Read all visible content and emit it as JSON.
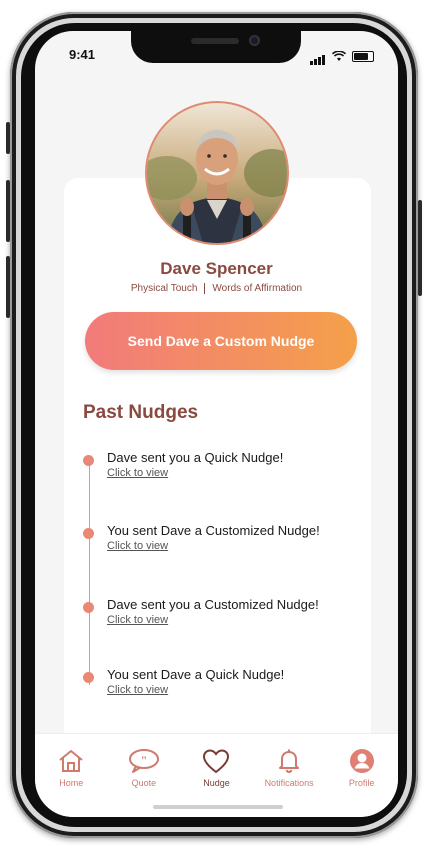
{
  "status_bar": {
    "time": "9:41"
  },
  "profile": {
    "name": "Dave Spencer",
    "love_languages": [
      "Physical Touch",
      "Words of Affirmation"
    ],
    "cta_label": "Send Dave a Custom Nudge"
  },
  "past_nudges": {
    "title": "Past Nudges",
    "items": [
      {
        "text": "Dave sent you a Quick Nudge!",
        "link": "Click to view"
      },
      {
        "text": "You sent Dave a Customized Nudge!",
        "link": "Click to view"
      },
      {
        "text": "Dave sent you a Customized Nudge!",
        "link": "Click to view"
      },
      {
        "text": "You sent Dave a Quick Nudge!",
        "link": "Click to view"
      }
    ]
  },
  "tabbar": {
    "items": [
      {
        "label": "Home",
        "icon": "home-icon"
      },
      {
        "label": "Quote",
        "icon": "quote-icon"
      },
      {
        "label": "Nudge",
        "icon": "heart-icon",
        "active": true
      },
      {
        "label": "Notifications",
        "icon": "bell-icon"
      },
      {
        "label": "Profile",
        "icon": "profile-icon"
      }
    ]
  },
  "colors": {
    "accent": "#8a4a40",
    "gradient_start": "#f27b7b",
    "gradient_end": "#f4a04a",
    "timeline_dot": "#ea8877"
  }
}
